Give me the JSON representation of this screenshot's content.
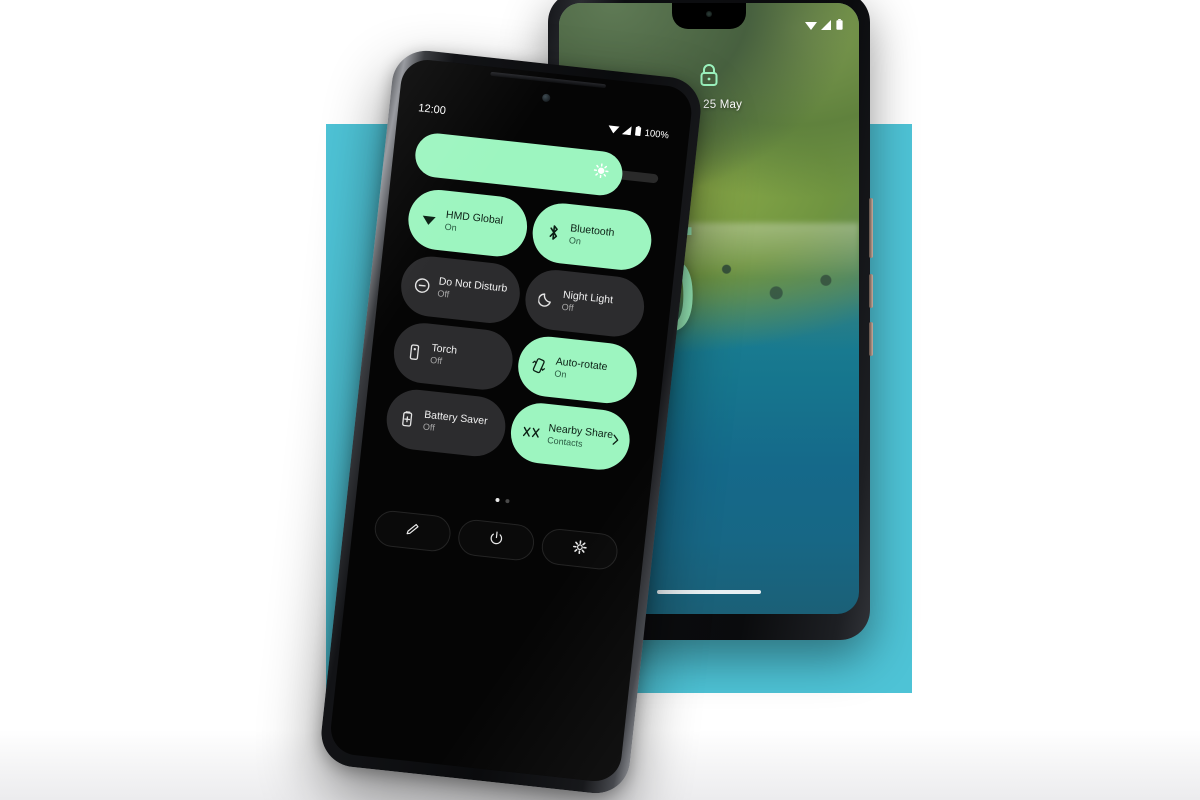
{
  "scene": {
    "background_color": "#ffffff",
    "accent_rect_color": "#4ec3d6",
    "mint_color": "#9df5c0",
    "tile_off_color": "#2c2c2e"
  },
  "lock_phone": {
    "status_bar": {
      "wifi_icon": "wifi-icon",
      "signal_icon": "signal-icon",
      "battery_icon": "battery-icon"
    },
    "lock_icon": "lock-icon",
    "date": "Thu, 25 May",
    "clock_hours": "12",
    "clock_minutes": "00",
    "home_indicator": "home-indicator"
  },
  "quick_settings_phone": {
    "status_bar": {
      "time": "12:00",
      "wifi_icon": "wifi-icon",
      "signal_icon": "signal-icon",
      "battery_icon": "battery-icon",
      "battery_level": "100%"
    },
    "brightness": {
      "name": "brightness-slider",
      "icon": "brightness-sun-icon",
      "value_percent": 85
    },
    "tiles": [
      {
        "icon": "wifi-icon",
        "name": "HMD Global",
        "state": "On",
        "active": true,
        "expandable": false
      },
      {
        "icon": "bluetooth-icon",
        "name": "Bluetooth",
        "state": "On",
        "active": true,
        "expandable": false
      },
      {
        "icon": "do-not-disturb-icon",
        "name": "Do Not Disturb",
        "state": "Off",
        "active": false,
        "expandable": false
      },
      {
        "icon": "night-light-icon",
        "name": "Night Light",
        "state": "Off",
        "active": false,
        "expandable": false
      },
      {
        "icon": "torch-icon",
        "name": "Torch",
        "state": "Off",
        "active": false,
        "expandable": false
      },
      {
        "icon": "auto-rotate-icon",
        "name": "Auto-rotate",
        "state": "On",
        "active": true,
        "expandable": false
      },
      {
        "icon": "battery-saver-icon",
        "name": "Battery Saver",
        "state": "Off",
        "active": false,
        "expandable": false
      },
      {
        "icon": "nearby-share-icon",
        "name": "Nearby Share",
        "state": "Contacts",
        "active": true,
        "expandable": true
      }
    ],
    "pager": {
      "pages": 2,
      "active_page": 1
    },
    "footer_buttons": [
      {
        "icon": "edit-pencil-icon",
        "label": "Edit"
      },
      {
        "icon": "power-icon",
        "label": "Power"
      },
      {
        "icon": "settings-gear-icon",
        "label": "Settings"
      }
    ]
  }
}
